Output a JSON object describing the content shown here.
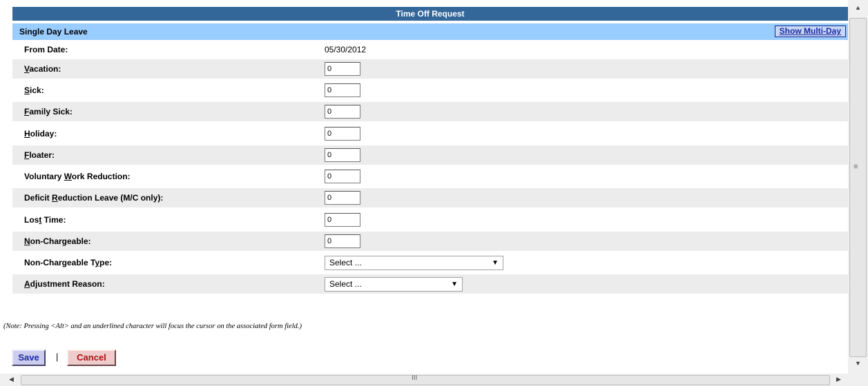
{
  "header": {
    "title": "Time Off Request"
  },
  "section": {
    "title": "Single Day Leave",
    "toggle_label": "Show Multi-Day"
  },
  "from_date": {
    "label": "From Date:",
    "value": "05/30/2012"
  },
  "fields": [
    {
      "pre": "",
      "key": "V",
      "post": "acation:",
      "value": "0"
    },
    {
      "pre": "",
      "key": "S",
      "post": "ick:",
      "value": "0"
    },
    {
      "pre": "",
      "key": "F",
      "post": "amily Sick:",
      "value": "0"
    },
    {
      "pre": "",
      "key": "H",
      "post": "oliday:",
      "value": "0"
    },
    {
      "pre": "",
      "key": "F",
      "post": "loater:",
      "value": "0"
    },
    {
      "pre": "Voluntary ",
      "key": "W",
      "post": "ork Reduction:",
      "value": "0"
    },
    {
      "pre": "Deficit ",
      "key": "R",
      "post": "eduction Leave (M/C only):",
      "value": "0"
    },
    {
      "pre": "Los",
      "key": "t",
      "post": " Time:",
      "value": "0"
    },
    {
      "pre": "",
      "key": "N",
      "post": "on-Chargeable:",
      "value": "0"
    }
  ],
  "selects": [
    {
      "pre": "Non-Chargeable T",
      "key": "y",
      "post": "pe:",
      "value": "Select ..."
    },
    {
      "pre": "",
      "key": "A",
      "post": "djustment Reason:",
      "value": "Select ..."
    }
  ],
  "note": "(Note: Pressing <Alt> and an underlined character will focus the cursor on the associated form field.)",
  "actions": {
    "save_label": "Save",
    "separator": "|",
    "cancel_label": "Cancel"
  },
  "icons": {
    "scroll_up": "▲",
    "scroll_down": "▼",
    "scroll_left": "◀",
    "scroll_right": "▶",
    "vgrip": "≡",
    "hgrip": "III",
    "dropdown": "▼"
  },
  "colors": {
    "title_bar": "#336699",
    "section_bar": "#99ccff",
    "alt_row": "#ececec"
  }
}
